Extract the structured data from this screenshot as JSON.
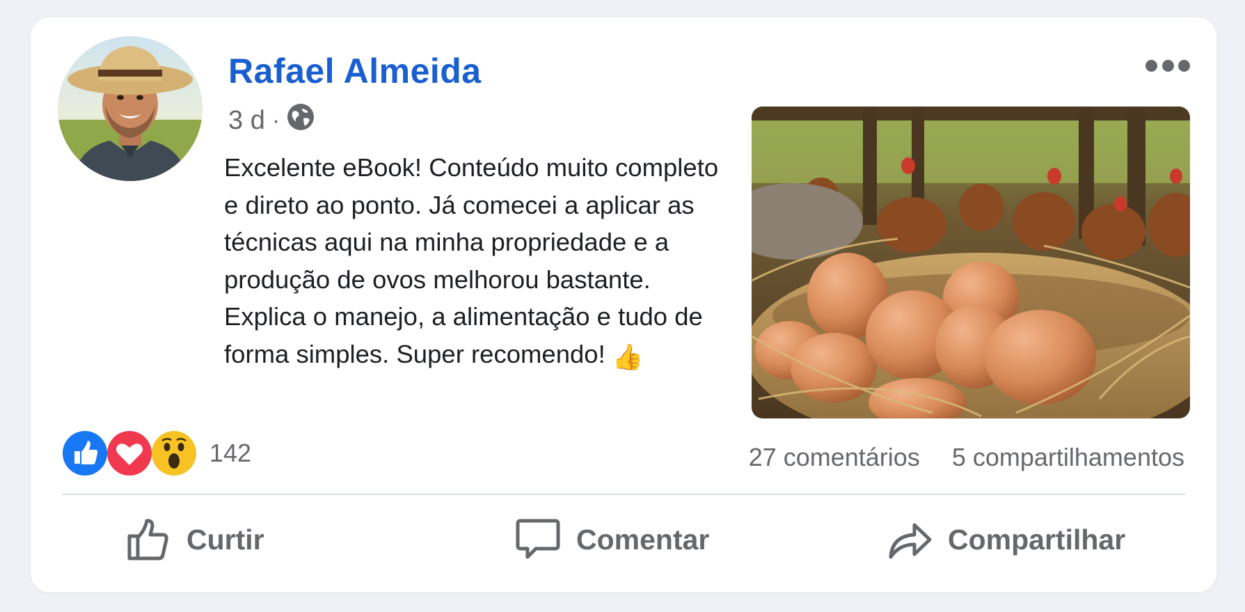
{
  "post": {
    "author": "Rafael Almeida",
    "time": "3 d",
    "separator": "·",
    "privacy_icon": "globe-icon",
    "more_icon": "more-options-icon",
    "text": "Excelente eBook! Conteúdo muito completo e direto ao ponto. Já comecei a aplicar as técnicas aqui na minha propriedade e a produção de ovos melhorou bastante. Explica o manejo, a alimentação e tudo de forma simples. Super recomendo!",
    "text_emoji": "👍",
    "image_description_icon": "eggs-in-nest-photo"
  },
  "reactions": {
    "icons": [
      "like-reaction-icon",
      "love-reaction-icon",
      "wow-reaction-icon"
    ],
    "count": "142",
    "colors": {
      "like": "#1877f2",
      "love": "#f0394e",
      "wow": "#f7c324"
    }
  },
  "stats": {
    "comments": "27 comentários",
    "shares": "5 compartilhamentos"
  },
  "actions": {
    "like": "Curtir",
    "comment": "Comentar",
    "share": "Compartilhar"
  },
  "colors": {
    "author_link": "#1a5fd0",
    "secondary_text": "#65676b",
    "body_text": "#1c1e21",
    "background": "#eef1f5"
  }
}
